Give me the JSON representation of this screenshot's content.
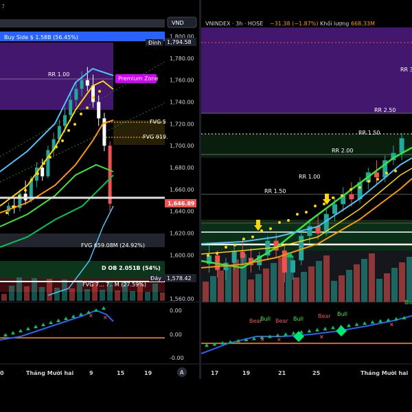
{
  "left": {
    "header_label": "7",
    "buy_side": "Buy Side  $ 1.58B (56.45%)",
    "currency_button": "VND",
    "price_axis": [
      "1,800.00",
      "1,780.00",
      "1,760.00",
      "1,740.00",
      "1,720.00",
      "1,700.00",
      "1,680.00",
      "1,660.00",
      "1,640.00",
      "1,620.00",
      "1,600.00",
      "1,580.00",
      "1,560.00"
    ],
    "peak_label": "Đỉnh",
    "peak_price": "1,794.58",
    "current_price": "1,646.89",
    "bottom_label": "Đáy",
    "bottom_price": "1,578.42",
    "rr_label": "RR 1.00",
    "premium_zone": "Premium Zone",
    "fvg_1": "FVG 5",
    "fvg_2": "FVG 919.",
    "fvg_3": "FVG 659.08M (24.92%)",
    "fvg_4": "FVG 7... 7.. M (27.59%)",
    "ob_label": "D OB 2.051B (54%)",
    "osc_axis": [
      "0.00",
      "0.00",
      "-0.00"
    ],
    "time_axis": [
      "0",
      "Tháng Mười hai",
      "9",
      "15",
      "19"
    ],
    "auto_button": "A"
  },
  "right": {
    "symbol": "VNINDEX · 3h · HOSE",
    "change": "−31.38 (−1.87%)",
    "volume_label": "Khối lượng",
    "volume_value": "668.33M",
    "rr_labels": [
      "RR 2.50",
      "RR 1.50",
      "RR 2.00",
      "RR 1.50",
      "RR 1.00",
      "RR 3"
    ],
    "signals": [
      "Bear",
      "Bull",
      "Bear",
      "Bull",
      "Bear",
      "Bull",
      "Bu"
    ],
    "time_axis": [
      "17",
      "19",
      "21",
      "25",
      "Tháng Mười hai"
    ]
  },
  "colors": {
    "bull": "#26a69a",
    "bear": "#ef5350",
    "premium": "#4a1a7a",
    "accent_yellow": "#ffd600",
    "accent_orange": "#ff9800",
    "accent_blue": "#2962ff",
    "green_line": "#39e639",
    "cyan_line": "#4fc3f7"
  },
  "chart_data": [
    {
      "type": "candlestick",
      "title": "",
      "price_range": [
        1560,
        1800
      ],
      "price_ticks": [
        1800,
        1780,
        1760,
        1740,
        1720,
        1700,
        1680,
        1660,
        1640,
        1620,
        1600,
        1580,
        1560
      ],
      "candles": [
        {
          "o": 1640,
          "h": 1648,
          "c": 1645,
          "l": 1636
        },
        {
          "o": 1645,
          "h": 1652,
          "c": 1643,
          "l": 1638
        },
        {
          "o": 1643,
          "h": 1660,
          "c": 1656,
          "l": 1640
        },
        {
          "o": 1656,
          "h": 1668,
          "c": 1650,
          "l": 1646
        },
        {
          "o": 1650,
          "h": 1672,
          "c": 1668,
          "l": 1648
        },
        {
          "o": 1668,
          "h": 1685,
          "c": 1680,
          "l": 1662
        },
        {
          "o": 1680,
          "h": 1688,
          "c": 1672,
          "l": 1668
        },
        {
          "o": 1672,
          "h": 1700,
          "c": 1696,
          "l": 1670
        },
        {
          "o": 1696,
          "h": 1712,
          "c": 1706,
          "l": 1690
        },
        {
          "o": 1706,
          "h": 1724,
          "c": 1718,
          "l": 1702
        },
        {
          "o": 1718,
          "h": 1735,
          "c": 1728,
          "l": 1712
        },
        {
          "o": 1728,
          "h": 1748,
          "c": 1742,
          "l": 1722
        },
        {
          "o": 1742,
          "h": 1758,
          "c": 1752,
          "l": 1736
        },
        {
          "o": 1752,
          "h": 1768,
          "c": 1760,
          "l": 1745
        },
        {
          "o": 1760,
          "h": 1772,
          "c": 1755,
          "l": 1750
        },
        {
          "o": 1755,
          "h": 1765,
          "c": 1740,
          "l": 1735
        },
        {
          "o": 1740,
          "h": 1746,
          "c": 1725,
          "l": 1718
        },
        {
          "o": 1725,
          "h": 1730,
          "c": 1700,
          "l": 1695
        },
        {
          "o": 1700,
          "h": 1704,
          "c": 1646.89,
          "l": 1640
        }
      ]
    },
    {
      "type": "candlestick",
      "title": "VNINDEX · 3h · HOSE",
      "candles": [
        {
          "o": 1605,
          "h": 1620,
          "c": 1612,
          "l": 1598
        },
        {
          "o": 1612,
          "h": 1616,
          "c": 1600,
          "l": 1594
        },
        {
          "o": 1600,
          "h": 1610,
          "c": 1606,
          "l": 1592
        },
        {
          "o": 1606,
          "h": 1620,
          "c": 1615,
          "l": 1600
        },
        {
          "o": 1615,
          "h": 1626,
          "c": 1610,
          "l": 1605
        },
        {
          "o": 1610,
          "h": 1618,
          "c": 1604,
          "l": 1598
        },
        {
          "o": 1604,
          "h": 1615,
          "c": 1612,
          "l": 1600
        },
        {
          "o": 1612,
          "h": 1628,
          "c": 1624,
          "l": 1608
        },
        {
          "o": 1624,
          "h": 1630,
          "c": 1616,
          "l": 1610
        },
        {
          "o": 1616,
          "h": 1622,
          "c": 1598,
          "l": 1590
        },
        {
          "o": 1598,
          "h": 1612,
          "c": 1608,
          "l": 1592
        },
        {
          "o": 1608,
          "h": 1632,
          "c": 1628,
          "l": 1604
        },
        {
          "o": 1628,
          "h": 1642,
          "c": 1636,
          "l": 1622
        },
        {
          "o": 1636,
          "h": 1646,
          "c": 1630,
          "l": 1625
        },
        {
          "o": 1630,
          "h": 1650,
          "c": 1646,
          "l": 1628
        },
        {
          "o": 1646,
          "h": 1660,
          "c": 1654,
          "l": 1640
        },
        {
          "o": 1654,
          "h": 1668,
          "c": 1662,
          "l": 1648
        },
        {
          "o": 1662,
          "h": 1672,
          "c": 1658,
          "l": 1652
        },
        {
          "o": 1658,
          "h": 1676,
          "c": 1672,
          "l": 1655
        },
        {
          "o": 1672,
          "h": 1684,
          "c": 1680,
          "l": 1666
        },
        {
          "o": 1680,
          "h": 1690,
          "c": 1676,
          "l": 1670
        },
        {
          "o": 1676,
          "h": 1694,
          "c": 1690,
          "l": 1672
        },
        {
          "o": 1690,
          "h": 1702,
          "c": 1696,
          "l": 1686
        },
        {
          "o": 1696,
          "h": 1712,
          "c": 1708,
          "l": 1690
        }
      ]
    }
  ]
}
